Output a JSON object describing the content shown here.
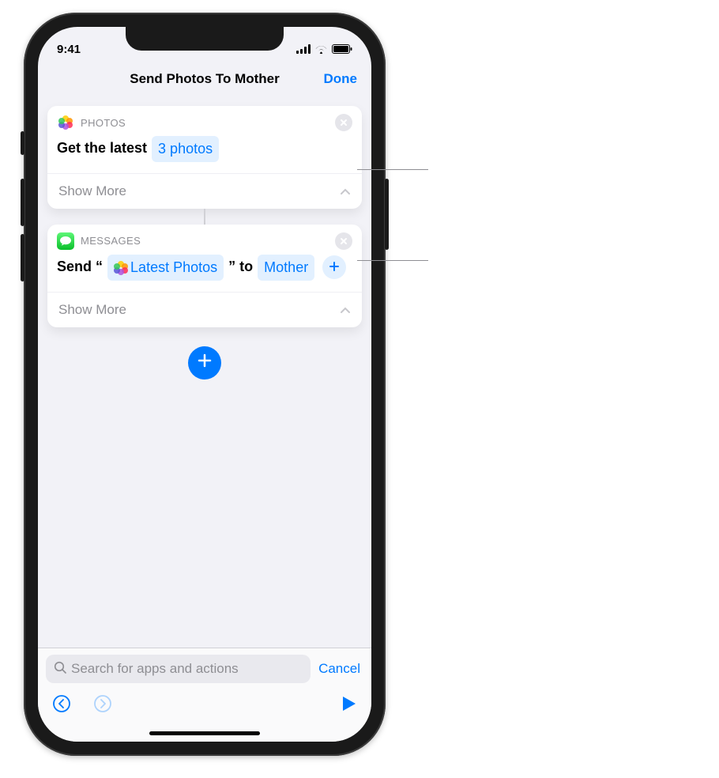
{
  "statusBar": {
    "time": "9:41"
  },
  "navBar": {
    "title": "Send Photos To Mother",
    "done": "Done"
  },
  "cards": {
    "photos": {
      "appLabel": "PHOTOS",
      "prefix": "Get the latest",
      "paramToken": "3 photos",
      "showMore": "Show More"
    },
    "messages": {
      "appLabel": "MESSAGES",
      "sendPrefix": "Send",
      "quoteOpen": "“",
      "variableToken": "Latest Photos",
      "quoteClose": "”",
      "toWord": "to",
      "recipientToken": "Mother",
      "showMore": "Show More"
    }
  },
  "bottom": {
    "searchPlaceholder": "Search for apps and actions",
    "cancel": "Cancel"
  }
}
